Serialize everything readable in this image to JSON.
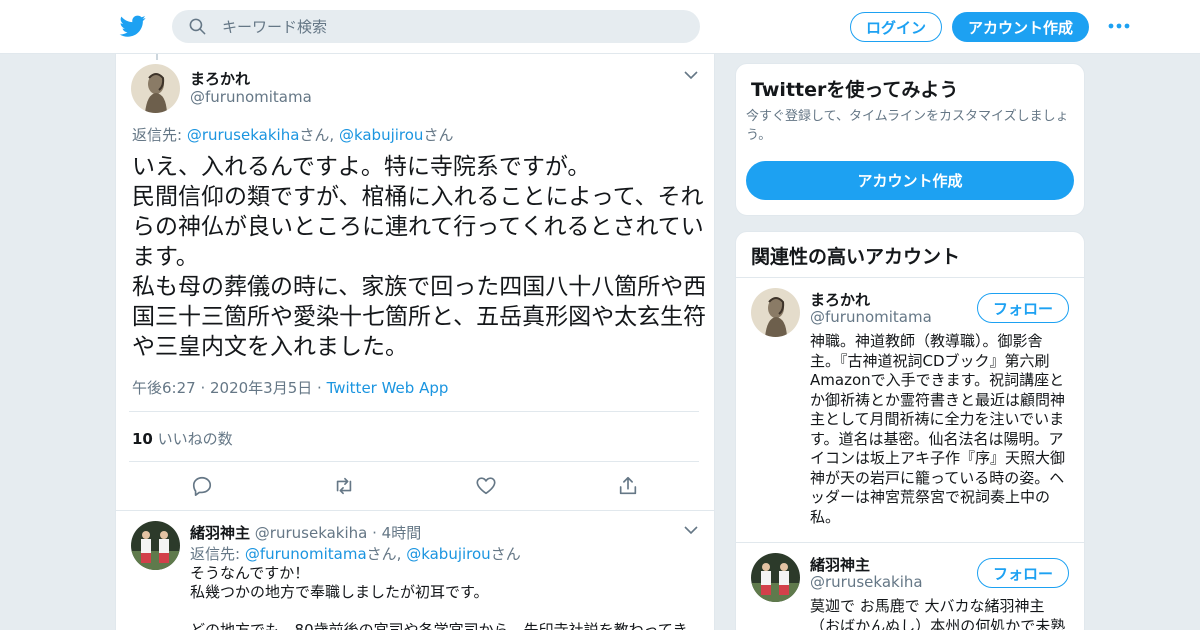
{
  "header": {
    "search_placeholder": "キーワード検索",
    "login_label": "ログイン",
    "signup_label": "アカウント作成",
    "brand_color": "#1da1f2"
  },
  "tweet": {
    "name": "まろかれ",
    "handle": "@furunomitama",
    "reply_prefix": "返信先: ",
    "reply_user1": "@rurusekakiha",
    "reply_suffix1": "さん, ",
    "reply_user2": "@kabujirou",
    "reply_suffix2": "さん",
    "text": "いえ、入れるんですよ。特に寺院系ですが。\n民間信仰の類ですが、棺桶に入れることによって、それらの神仏が良いところに連れて行ってくれるとされています。\n私も母の葬儀の時に、家族で回った四国八十八箇所や西国三十三箇所や愛染十七箇所と、五岳真形図や太玄生符や三皇内文を入れました。",
    "timestamp": "午後6:27 · 2020年3月5日",
    "separator": " · ",
    "source": "Twitter Web App",
    "likes_count": "10",
    "likes_label": " いいねの数"
  },
  "reply": {
    "name": "緒羽神主",
    "handle": "@rurusekakiha",
    "time_sep": " · ",
    "time": "4時間",
    "reply_prefix": "返信先: ",
    "reply_user1": "@furunomitama",
    "reply_suffix1": "さん, ",
    "reply_user2": "@kabujirou",
    "reply_suffix2": "さん",
    "text": "そうなんですか！\n私幾つかの地方で奉職しましたが初耳です。\n\nどの地方でも、80歳前後の宮司や各学宮司から、先印寺社説を教わってき"
  },
  "sidebar": {
    "try_title": "Twitterを使ってみよう",
    "try_sub": "今すぐ登録して、タイムラインをカスタマイズしましょう。",
    "try_button": "アカウント作成",
    "related_title": "関連性の高いアカウント",
    "follow_label": "フォロー",
    "accounts": [
      {
        "name": "まろかれ",
        "handle": "@furunomitama",
        "bio": "神職。神道教師（教導職）。御影舎主。『古神道祝詞CDブック』第六刷Amazonで入手できます。祝詞講座とか御祈祷とか霊符書きと最近は顧問神主として月間祈祷に全力を注いでいます。道名は基密。仙名法名は陽明。アイコンは坂上アキ子作『序』天照大御神が天の岩戸に籠っている時の姿。ヘッダーは神宮荒祭宮で祝詞奏上中の私。"
      },
      {
        "name": "緒羽神主",
        "handle": "@rurusekakiha",
        "bio": "莫迦で お馬鹿で 大バカな緒羽神主（おばかんぬし）本州の何処かで未熟"
      }
    ]
  }
}
